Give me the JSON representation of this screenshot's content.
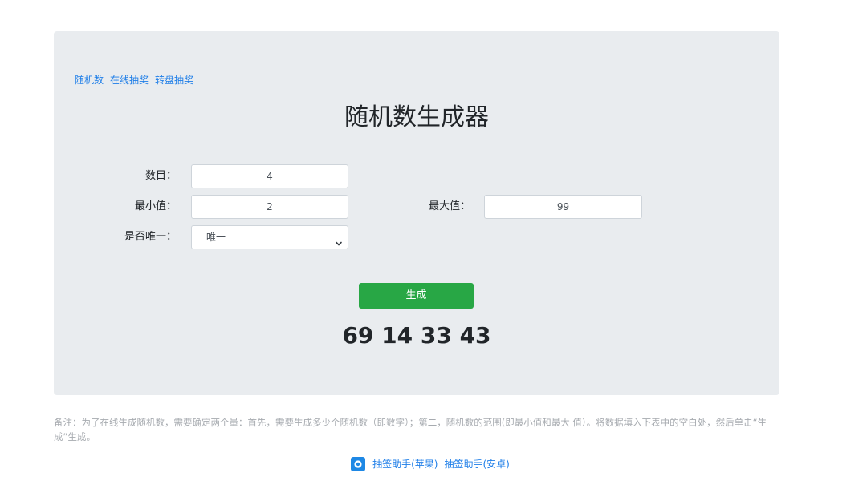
{
  "nav": {
    "items": [
      {
        "label": "随机数"
      },
      {
        "label": "在线抽奖"
      },
      {
        "label": "转盘抽奖"
      }
    ]
  },
  "page": {
    "title": "随机数生成器"
  },
  "form": {
    "count_label": "数目：",
    "count_value": "4",
    "min_label": "最小值：",
    "min_value": "2",
    "max_label": "最大值：",
    "max_value": "99",
    "unique_label": "是否唯一：",
    "unique_selected": "唯一",
    "generate_label": "生成"
  },
  "result": {
    "numbers": "69 14 33 43"
  },
  "note": {
    "text": "备注：为了在线生成随机数，需要确定两个量：首先，需要生成多少个随机数（即数字）；第二，随机数的范围(即最小值和最大 值）。将数据填入下表中的空白处，然后单击“生成”生成。"
  },
  "footer": {
    "app_icon": "lottery-app-icon",
    "link_ios": "抽签助手(苹果)",
    "link_android": "抽签助手(安卓)"
  },
  "colors": {
    "panel_bg": "#e9ecef",
    "link": "#1e7ee8",
    "button_green": "#28a745",
    "icon_blue": "#1e88e5"
  }
}
